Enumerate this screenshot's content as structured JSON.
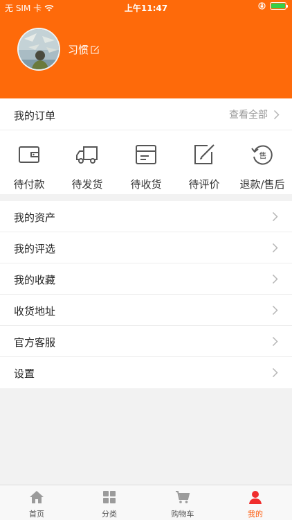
{
  "status_bar": {
    "carrier": "无 SIM 卡",
    "time": "上午11:47",
    "battery_level": 1.0,
    "battery_color": "#33d04a"
  },
  "profile": {
    "username": "习惯"
  },
  "orders": {
    "title": "我的订单",
    "view_all": "查看全部",
    "items": [
      {
        "label": "待付款",
        "icon": "wallet-icon"
      },
      {
        "label": "待发货",
        "icon": "truck-icon"
      },
      {
        "label": "待收货",
        "icon": "box-icon"
      },
      {
        "label": "待评价",
        "icon": "edit-review-icon"
      },
      {
        "label": "退款/售后",
        "icon": "refund-icon"
      }
    ]
  },
  "menu": {
    "items": [
      {
        "label": "我的资产"
      },
      {
        "label": "我的评选"
      },
      {
        "label": "我的收藏"
      },
      {
        "label": "收货地址"
      },
      {
        "label": "官方客服"
      },
      {
        "label": "设置"
      }
    ]
  },
  "tabbar": {
    "items": [
      {
        "label": "首页",
        "icon": "home-icon"
      },
      {
        "label": "分类",
        "icon": "grid-icon"
      },
      {
        "label": "购物车",
        "icon": "cart-icon"
      },
      {
        "label": "我的",
        "icon": "user-icon"
      }
    ],
    "active_index": 3
  },
  "colors": {
    "brand": "#fe6a0a",
    "active_tab": "#fe5a0a",
    "background": "#f2f2f2"
  }
}
